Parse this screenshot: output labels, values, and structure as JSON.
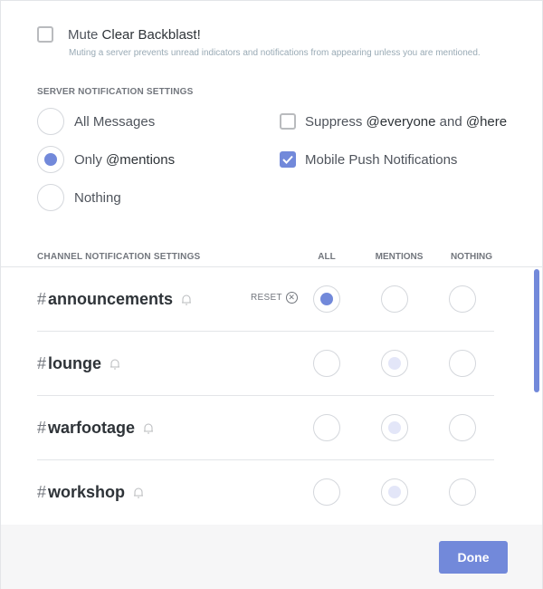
{
  "mute": {
    "prefix": "Mute",
    "server_name": "Clear Backblast!",
    "description": "Muting a server prevents unread indicators and notifications from appearing unless you are mentioned.",
    "checked": false
  },
  "server_settings": {
    "title": "SERVER NOTIFICATION SETTINGS",
    "options": [
      {
        "label": "All Messages",
        "selected": false
      },
      {
        "label_plain": "Only ",
        "label_bold": "@mentions",
        "selected": true
      },
      {
        "label": "Nothing",
        "selected": false
      }
    ],
    "suppress": {
      "prefix": "Suppress ",
      "everyone": "@everyone",
      "and": " and ",
      "here": "@here",
      "checked": false
    },
    "mobile_push": {
      "label": "Mobile Push Notifications",
      "checked": true
    }
  },
  "channel_settings": {
    "title": "CHANNEL NOTIFICATION SETTINGS",
    "columns": [
      "ALL",
      "MENTIONS",
      "NOTHING"
    ],
    "reset_label": "RESET",
    "channels": [
      {
        "hash": "#",
        "name": "announcements",
        "selected": "ALL",
        "has_reset": true
      },
      {
        "hash": "#",
        "name": "lounge",
        "selected": "MENTIONS",
        "has_reset": false
      },
      {
        "hash": "#",
        "name": "warfootage",
        "selected": "MENTIONS",
        "has_reset": false
      },
      {
        "hash": "#",
        "name": "workshop",
        "selected": "MENTIONS",
        "has_reset": false
      }
    ]
  },
  "footer": {
    "done_label": "Done"
  },
  "colors": {
    "accent": "#7289da",
    "faint_accent": "#e3e6f8"
  }
}
